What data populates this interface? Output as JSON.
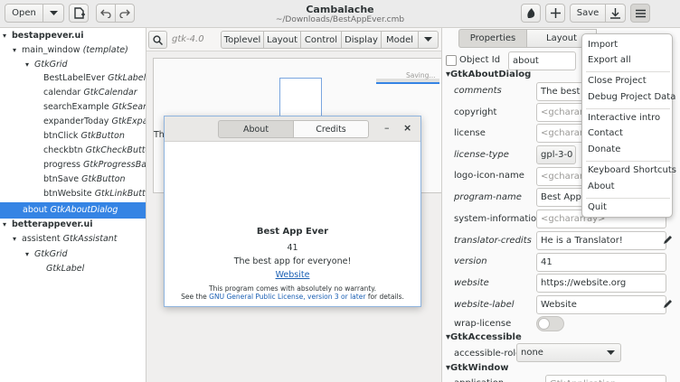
{
  "header": {
    "title": "Cambalache",
    "subtitle": "~/Downloads/BestAppEver.cmb",
    "open_label": "Open",
    "save_label": "Save"
  },
  "tree": {
    "rows": [
      {
        "a": "bestappever.ui",
        "b": ""
      },
      {
        "a": "main_window",
        "b": "(template)"
      },
      {
        "a": "",
        "b": "GtkGrid"
      },
      {
        "a": "BestLabelEver",
        "b": "GtkLabel"
      },
      {
        "a": "calendar",
        "b": "GtkCalendar"
      },
      {
        "a": "searchExample",
        "b": "GtkSearch"
      },
      {
        "a": "expanderToday",
        "b": "GtkExpan"
      },
      {
        "a": "btnClick",
        "b": "GtkButton"
      },
      {
        "a": "checkbtn",
        "b": "GtkCheckButtor"
      },
      {
        "a": "progress",
        "b": "GtkProgressBar"
      },
      {
        "a": "btnSave",
        "b": "GtkButton"
      },
      {
        "a": "btnWebsite",
        "b": "GtkLinkButto"
      },
      {
        "a": "about",
        "b": "GtkAboutDialog"
      },
      {
        "a": "betterappever.ui",
        "b": ""
      },
      {
        "a": "assistent",
        "b": "GtkAssistant"
      },
      {
        "a": "",
        "b": "GtkGrid"
      },
      {
        "a": "",
        "b": "GtkLabel"
      }
    ]
  },
  "center": {
    "gtk_version": "gtk-4.0",
    "tabs": [
      "Toplevel",
      "Layout",
      "Control",
      "Display",
      "Model"
    ],
    "saving_text": "Saving...",
    "canvas_letters": "Th"
  },
  "dialog": {
    "tab_about": "About",
    "tab_credits": "Credits",
    "app_name": "Best App Ever",
    "version": "41",
    "comments": "The best app for everyone!",
    "website": "Website",
    "warranty": "This program comes with absolutely no warranty.",
    "license_pre": "See the",
    "license_link": "GNU General Public License, version 3 or later",
    "license_post": "for details."
  },
  "props": {
    "tab_properties": "Properties",
    "tab_layout": "Layout",
    "object_id_label": "Object Id",
    "object_id_value": "about",
    "section_about": "GtkAboutDialog",
    "section_accessible": "GtkAccessible",
    "section_window": "GtkWindow",
    "rows": [
      {
        "label": "comments",
        "value": "The best a",
        "placeholder": false,
        "italic": true
      },
      {
        "label": "copyright",
        "value": "<gchararray>",
        "placeholder": true,
        "italic": false
      },
      {
        "label": "license",
        "value": "<gchararray>",
        "placeholder": true,
        "italic": false
      },
      {
        "label": "license-type",
        "value": "gpl-3-0",
        "placeholder": false,
        "italic": true
      },
      {
        "label": "logo-icon-name",
        "value": "<gchararray>",
        "placeholder": true,
        "italic": false
      },
      {
        "label": "program-name",
        "value": "Best App E",
        "placeholder": false,
        "italic": true
      },
      {
        "label": "system-information",
        "value": "<gchararray>",
        "placeholder": true,
        "italic": false
      },
      {
        "label": "translator-credits",
        "value": "He is a Translator!",
        "placeholder": false,
        "italic": true
      },
      {
        "label": "version",
        "value": "41",
        "placeholder": false,
        "italic": true
      },
      {
        "label": "website",
        "value": "https://website.org",
        "placeholder": false,
        "italic": true
      },
      {
        "label": "website-label",
        "value": "Website",
        "placeholder": false,
        "italic": true
      }
    ],
    "wrap_license_label": "wrap-license",
    "accessible_role_label": "accessible-role",
    "accessible_role_value": "none",
    "window_row_label": "application",
    "window_row_value": "GtkApplication"
  },
  "menu": {
    "items": [
      "Import",
      "Export all",
      "Close Project",
      "Debug Project Data",
      "Interactive intro",
      "Contact",
      "Donate",
      "Keyboard Shortcuts",
      "About",
      "Quit"
    ]
  },
  "colors": {
    "accent": "#3584e4",
    "link": "#1a5fb4"
  }
}
